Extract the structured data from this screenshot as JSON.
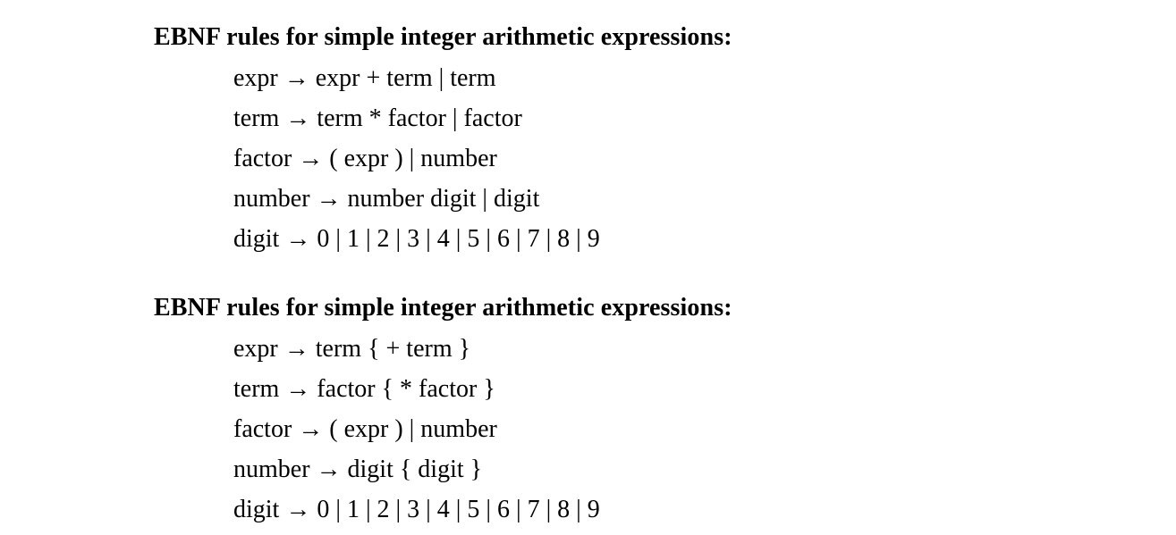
{
  "sections": [
    {
      "heading": "EBNF rules for simple integer arithmetic expressions:",
      "rules": [
        "expr → expr + term | term",
        "term → term * factor | factor",
        "factor → ( expr ) | number",
        "number → number digit | digit",
        "digit → 0 | 1 | 2 | 3 | 4 | 5 | 6 | 7 | 8 | 9"
      ]
    },
    {
      "heading": "EBNF rules for simple integer arithmetic expressions:",
      "rules": [
        "expr → term { + term }",
        "term → factor { * factor }",
        "factor → ( expr ) | number",
        "number → digit { digit }",
        "digit → 0 | 1 | 2 | 3 | 4 | 5 | 6 | 7 | 8 | 9"
      ]
    }
  ]
}
